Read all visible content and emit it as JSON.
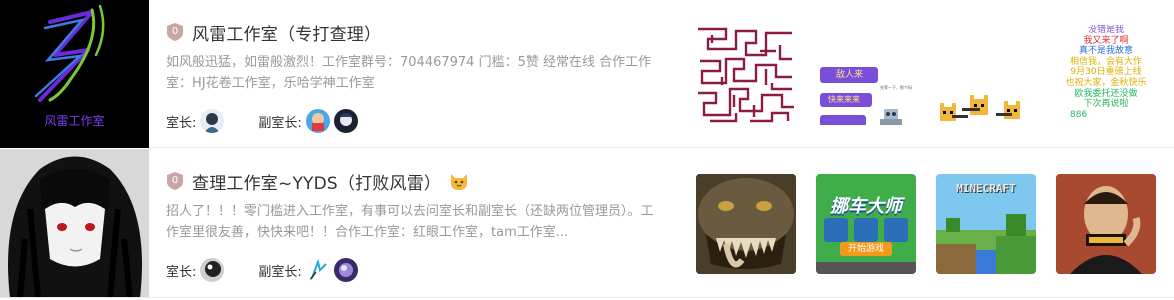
{
  "studios": [
    {
      "cover_caption": "风雷工作室",
      "level": "0",
      "title": "风雷工作室（专打查理）",
      "description": "如风般迅猛，如雷般激烈！工作室群号：704467974 门槛：5赞 经常在线 合作工作室：HJ花卷工作室，乐哈学神工作室",
      "owner_label": "室长:",
      "deputy_label": "副室长:",
      "works": [
        {
          "icon": "maze-pattern-thumbnail"
        },
        {
          "icon": "purple-buttons-game-thumbnail",
          "buttons": [
            "敌人来",
            "快来来来",
            "跑跑"
          ],
          "caption": "先等一下，那个码"
        },
        {
          "icon": "pixel-cats-thumbnail"
        },
        {
          "icon": "colorful-text-thumbnail",
          "lines": [
            {
              "text": "没错是我",
              "color": "#8a4fd8"
            },
            {
              "text": "我又来了啊",
              "color": "#e03030"
            },
            {
              "text": "真不是我故意",
              "color": "#2b6fd8"
            },
            {
              "text": "相信我，会有大作",
              "color": "#e0b000"
            },
            {
              "text": "9月30日重磅上线",
              "color": "#e0b000"
            },
            {
              "text": "也祝大家，金秋快乐",
              "color": "#e0b000"
            },
            {
              "text": "欧我委托还没做",
              "color": "#25b860"
            },
            {
              "text": "下次再说啦",
              "color": "#25b860"
            },
            {
              "text": "886",
              "color": "#25b860"
            }
          ]
        }
      ]
    },
    {
      "level": "0",
      "title": "查理工作室~YYDS（打败风雷）",
      "description": "招人了！！！零门槛进入工作室，有事可以去问室长和副室长（还缺两位管理员）。工作室里很友善，快快来吧！！合作工作室：红眼工作室，tam工作室...",
      "owner_label": "室长:",
      "deputy_label": "副室长:",
      "works": [
        {
          "icon": "beast-monster-thumbnail"
        },
        {
          "icon": "parking-game-thumbnail",
          "title": "挪车大师",
          "start": "开始游戏"
        },
        {
          "icon": "minecraft-thumbnail",
          "title": "MINECRAFT"
        },
        {
          "icon": "man-portrait-thumbnail"
        }
      ]
    }
  ],
  "colors": {
    "badge": "#c9a6a6",
    "maze": "#8b1e3f",
    "purple": "#7a4fd8"
  }
}
